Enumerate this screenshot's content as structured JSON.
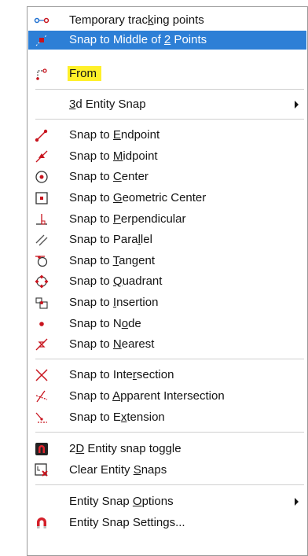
{
  "menu": {
    "items": [
      {
        "pre": "Temporary trac",
        "key": "k",
        "post": "ing points",
        "icon": "tracking-points-icon"
      },
      {
        "pre": "Snap to Middle of ",
        "key": "2",
        "post": " Points",
        "icon": "snap-middle-two-points-icon"
      },
      {
        "pre": "From",
        "key": "",
        "post": "",
        "icon": "from-icon"
      },
      {
        "pre": "",
        "key": "3",
        "post": "d Entity Snap",
        "icon": ""
      },
      {
        "pre": "Snap to ",
        "key": "E",
        "post": "ndpoint",
        "icon": "endpoint-icon"
      },
      {
        "pre": "Snap to ",
        "key": "M",
        "post": "idpoint",
        "icon": "midpoint-icon"
      },
      {
        "pre": "Snap to ",
        "key": "C",
        "post": "enter",
        "icon": "center-icon"
      },
      {
        "pre": "Snap to ",
        "key": "G",
        "post": "eometric Center",
        "icon": "geometric-center-icon"
      },
      {
        "pre": "Snap to ",
        "key": "P",
        "post": "erpendicular",
        "icon": "perpendicular-icon"
      },
      {
        "pre": "Snap to Para",
        "key": "l",
        "post": "lel",
        "icon": "parallel-icon"
      },
      {
        "pre": "Snap to ",
        "key": "T",
        "post": "angent",
        "icon": "tangent-icon"
      },
      {
        "pre": "Snap to ",
        "key": "Q",
        "post": "uadrant",
        "icon": "quadrant-icon"
      },
      {
        "pre": "Snap to ",
        "key": "I",
        "post": "nsertion",
        "icon": "insertion-icon"
      },
      {
        "pre": "Snap to N",
        "key": "o",
        "post": "de",
        "icon": "node-icon"
      },
      {
        "pre": "Snap to ",
        "key": "N",
        "post": "earest",
        "icon": "nearest-icon"
      },
      {
        "pre": "Snap to Inte",
        "key": "r",
        "post": "section",
        "icon": "intersection-icon"
      },
      {
        "pre": "Snap to ",
        "key": "A",
        "post": "pparent Intersection",
        "icon": "apparent-intersection-icon"
      },
      {
        "pre": "Snap to E",
        "key": "x",
        "post": "tension",
        "icon": "extension-icon"
      },
      {
        "pre": "2",
        "key": "D",
        "post": " Entity snap toggle",
        "icon": "entity-snap-toggle-icon"
      },
      {
        "pre": "Clear Entity ",
        "key": "S",
        "post": "naps",
        "icon": "clear-entity-snaps-icon"
      },
      {
        "pre": "Entity Snap ",
        "key": "O",
        "post": "ptions",
        "icon": ""
      },
      {
        "pre": "Entity Snap Settings...",
        "key": "",
        "post": "",
        "icon": "entity-snap-settings-icon"
      }
    ]
  },
  "colors": {
    "selected_background": "#2d7fd6",
    "highlight": "#fff02a",
    "icon_red": "#c8141e"
  }
}
